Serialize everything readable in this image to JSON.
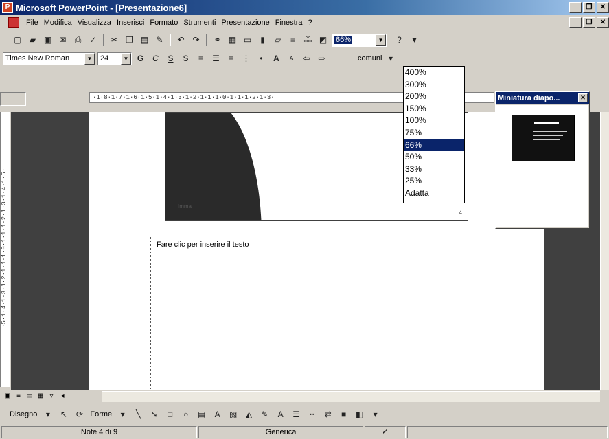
{
  "window": {
    "title": "Microsoft PowerPoint - [Presentazione6]",
    "app_icon": "powerpoint-icon",
    "buttons": [
      "_",
      "❐",
      "✕"
    ]
  },
  "menubar": {
    "items": [
      "File",
      "Modifica",
      "Visualizza",
      "Inserisci",
      "Formato",
      "Strumenti",
      "Presentazione",
      "Finestra",
      "?"
    ]
  },
  "toolbar_standard": {
    "zoom_value": "66%"
  },
  "toolbar_format": {
    "font": "Times New Roman",
    "size": "24",
    "bold": "G",
    "italic": "C",
    "underline": "S",
    "shadow": "S",
    "tasks_label": "comuni"
  },
  "ruler": {
    "horizontal": "·1·8·1·7·1·6·1·5·1·4·1·3·1·2·1·1·1·0·1·1·1·2·1·3·",
    "vertical": "·5·1·4·1·3·1·2·1·1·1·0·1·1·1·2·1·3·1·4·1·5·"
  },
  "zoom_dropdown": {
    "options": [
      "400%",
      "300%",
      "200%",
      "150%",
      "100%",
      "75%",
      "66%",
      "50%",
      "33%",
      "25%",
      "Adatta"
    ],
    "selected_index": 6
  },
  "thumbnail": {
    "title": "Miniatura diapo...",
    "close": "✕"
  },
  "slide": {
    "shape_label": "Imma",
    "corner_mark": "4"
  },
  "notes": {
    "placeholder": "Fare clic per inserire il testo"
  },
  "drawbar": {
    "draw_label": "Disegno",
    "shapes_label": "Forme"
  },
  "statusbar": {
    "slide_info": "Note 4 di 9",
    "design": "Generica"
  },
  "colors": {
    "titlebar_start": "#0a246a",
    "titlebar_end": "#a6caf0",
    "selection": "#0a246a",
    "chrome": "#d4d0c8"
  }
}
